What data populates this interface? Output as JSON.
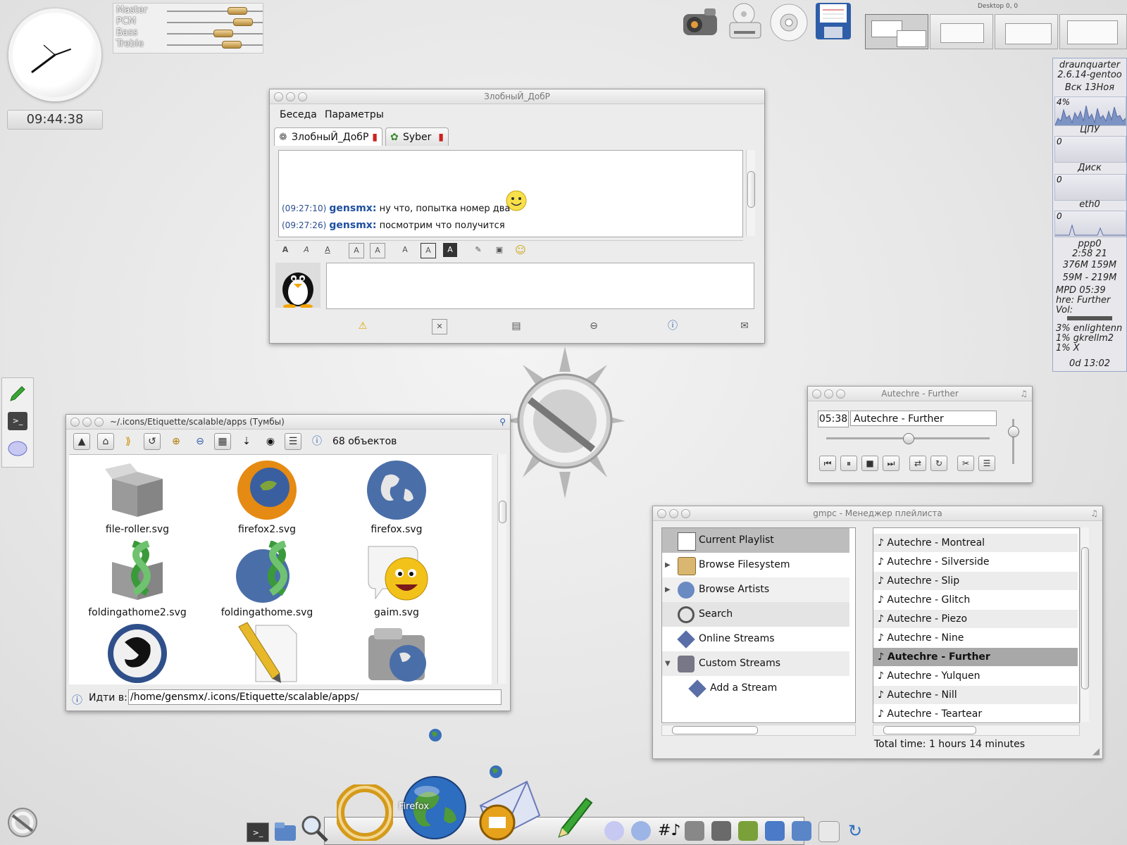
{
  "clock": {
    "time": "09:44:38"
  },
  "mixer": {
    "channels": [
      {
        "label": "Master",
        "level": 0.7
      },
      {
        "label": "PCM",
        "level": 0.76
      },
      {
        "label": "Bass",
        "level": 0.55
      },
      {
        "label": "Treble",
        "level": 0.62
      }
    ]
  },
  "pager": {
    "label": "Desktop 0, 0"
  },
  "gkrellm": {
    "host": "draunquarter",
    "kernel": "2.6.14-gentoo",
    "date": "Вск 13Ноя",
    "cpu_pct": "4%",
    "cpu_label": "ЦПУ",
    "disk_val": "0",
    "disk_label": "Диск",
    "eth_val": "0",
    "eth_label": "eth0",
    "ppp_val": "0",
    "ppp_label": "ppp0",
    "ppp_time": "2:58 21",
    "mem1": "376M  159M",
    "mem2": "59M - 219M",
    "mpd": "MPD 05:39",
    "mpd_song": "hre: Further",
    "vol": "Vol:",
    "proc1": "3% enlightenn",
    "proc2": "1% gkrellm2",
    "proc3": "1% X",
    "uptime": "0d 13:02"
  },
  "chat": {
    "title": "ЗлобныЙ_ДобР",
    "menu": [
      "Беседа",
      "Параметры"
    ],
    "tabs": [
      "ЗлобныЙ_ДобР",
      "Syber"
    ],
    "messages": [
      {
        "time": "(09:27:10)",
        "nick": "gensmx:",
        "text": "ну что, попытка номер два"
      },
      {
        "time": "(09:27:26)",
        "nick": "gensmx:",
        "text": "посмотрим что получится"
      }
    ],
    "format_buttons": [
      "A",
      "A",
      "A",
      "A",
      "A",
      "A",
      "A",
      "A"
    ]
  },
  "filemanager": {
    "title": "~/.icons/Etiquette/scalable/apps (Тумбы)",
    "count": "68 объектов",
    "goto_label": "Идти в:",
    "path": "/home/gensmx/.icons/Etiquette/scalable/apps/",
    "items": [
      "file-roller.svg",
      "firefox2.svg",
      "firefox.svg",
      "foldingathome2.svg",
      "foldingathome.svg",
      "gaim.svg",
      "",
      "",
      ""
    ]
  },
  "player": {
    "title": "Autechre - Further",
    "time": "05:38",
    "track": "Autechre - Further",
    "progress": 0.5
  },
  "gmpc": {
    "title": "gmpc - Менеджер плейлиста",
    "nav": [
      "Current Playlist",
      "Browse Filesystem",
      "Browse Artists",
      "Search",
      "Online Streams",
      "Custom Streams",
      "Add a Stream"
    ],
    "songs": [
      "Autechre - Montreal",
      "Autechre - Silverside",
      "Autechre - Slip",
      "Autechre - Glitch",
      "Autechre - Piezo",
      "Autechre - Nine",
      "Autechre - Further",
      "Autechre - Yulquen",
      "Autechre - Nill",
      "Autechre - Teartear"
    ],
    "current_song_index": 6,
    "total": "Total time: 1 hours 14 minutes"
  },
  "dock": {
    "firefox_label": "Firefox"
  },
  "colors": {
    "accent": "#1f4fa0",
    "selected_row": "#a8a8a8"
  }
}
